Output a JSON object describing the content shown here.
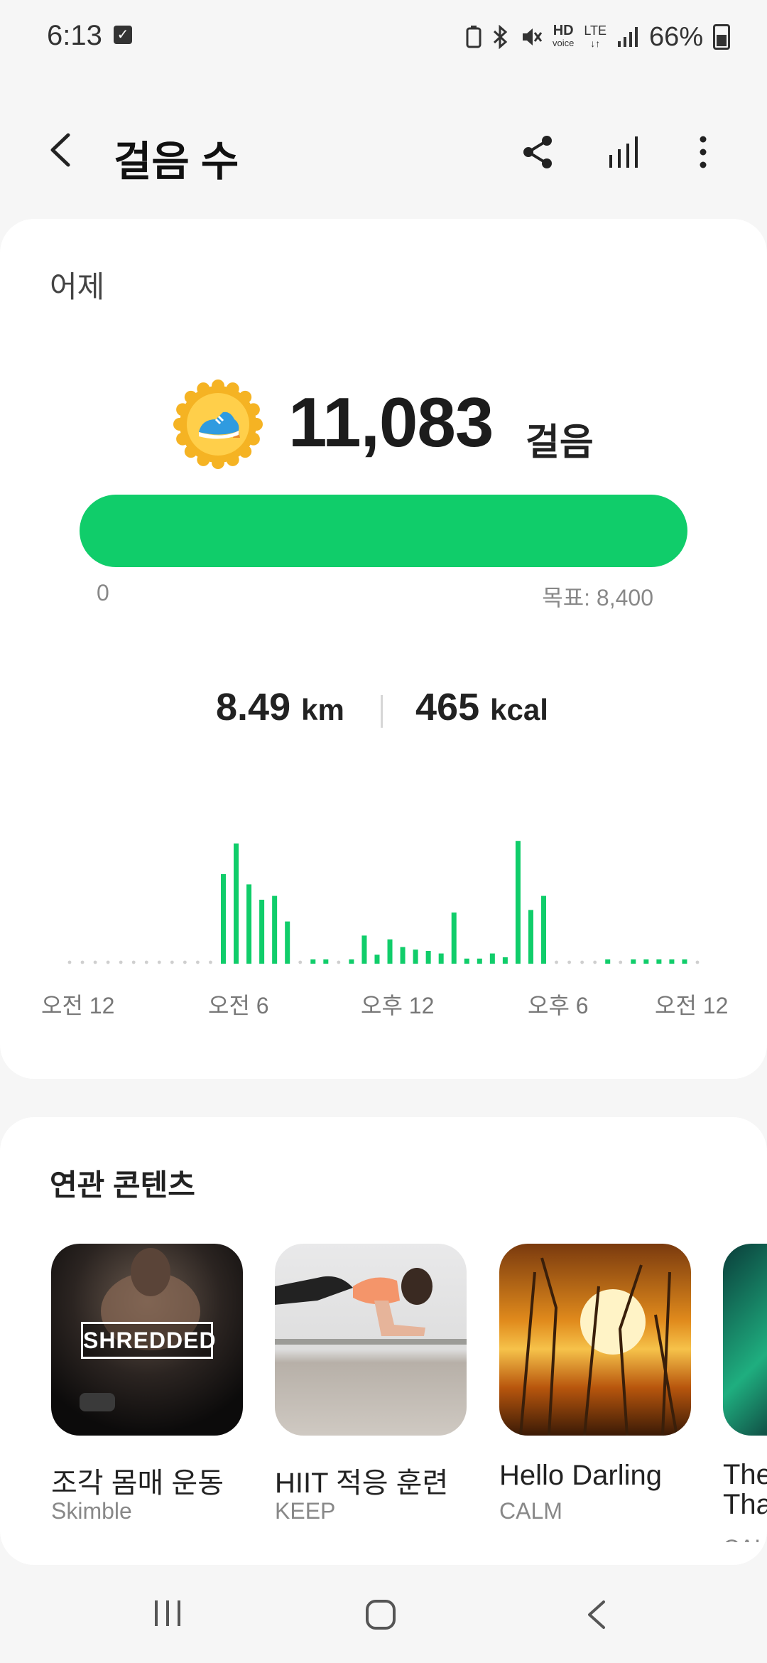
{
  "status_bar": {
    "time": "6:13",
    "hd_label": "HD",
    "voice_label": "voice",
    "lte_label": "LTE",
    "battery": "66%"
  },
  "header": {
    "title": "걸음 수"
  },
  "summary": {
    "period": "어제",
    "steps": "11,083",
    "steps_unit": "걸음",
    "progress_fraction": 1.0,
    "scale_min": "0",
    "goal": "목표: 8,400",
    "distance": "8.49",
    "distance_unit": "km",
    "calories": "465",
    "calories_unit": "kcal"
  },
  "chart_data": {
    "type": "bar",
    "x_tick_labels": [
      "오전 12",
      "오전 6",
      "오후 12",
      "오후 6",
      "오전 12"
    ],
    "values": [
      0,
      0,
      0,
      0,
      0,
      0,
      0,
      0,
      0,
      0,
      0,
      0,
      700,
      940,
      620,
      500,
      530,
      330,
      0,
      20,
      20,
      0,
      20,
      220,
      70,
      190,
      130,
      110,
      100,
      80,
      400,
      40,
      40,
      80,
      50,
      960,
      420,
      530,
      0,
      0,
      0,
      0,
      20,
      0,
      20,
      20,
      20,
      20,
      20,
      0
    ],
    "ylim": [
      0,
      1000
    ],
    "color": "#10cd6a",
    "dot_color": "#cfcfcf"
  },
  "related": {
    "title": "연관 콘텐츠",
    "items": [
      {
        "name": "조각 몸매 운동",
        "source": "Skimble",
        "thumb_text": "SHREDDED"
      },
      {
        "name": "HIIT 적응 훈련",
        "source": "KEEP"
      },
      {
        "name": "Hello Darling",
        "source": "CALM"
      },
      {
        "name": "The Tha",
        "source": "CAL"
      }
    ]
  }
}
